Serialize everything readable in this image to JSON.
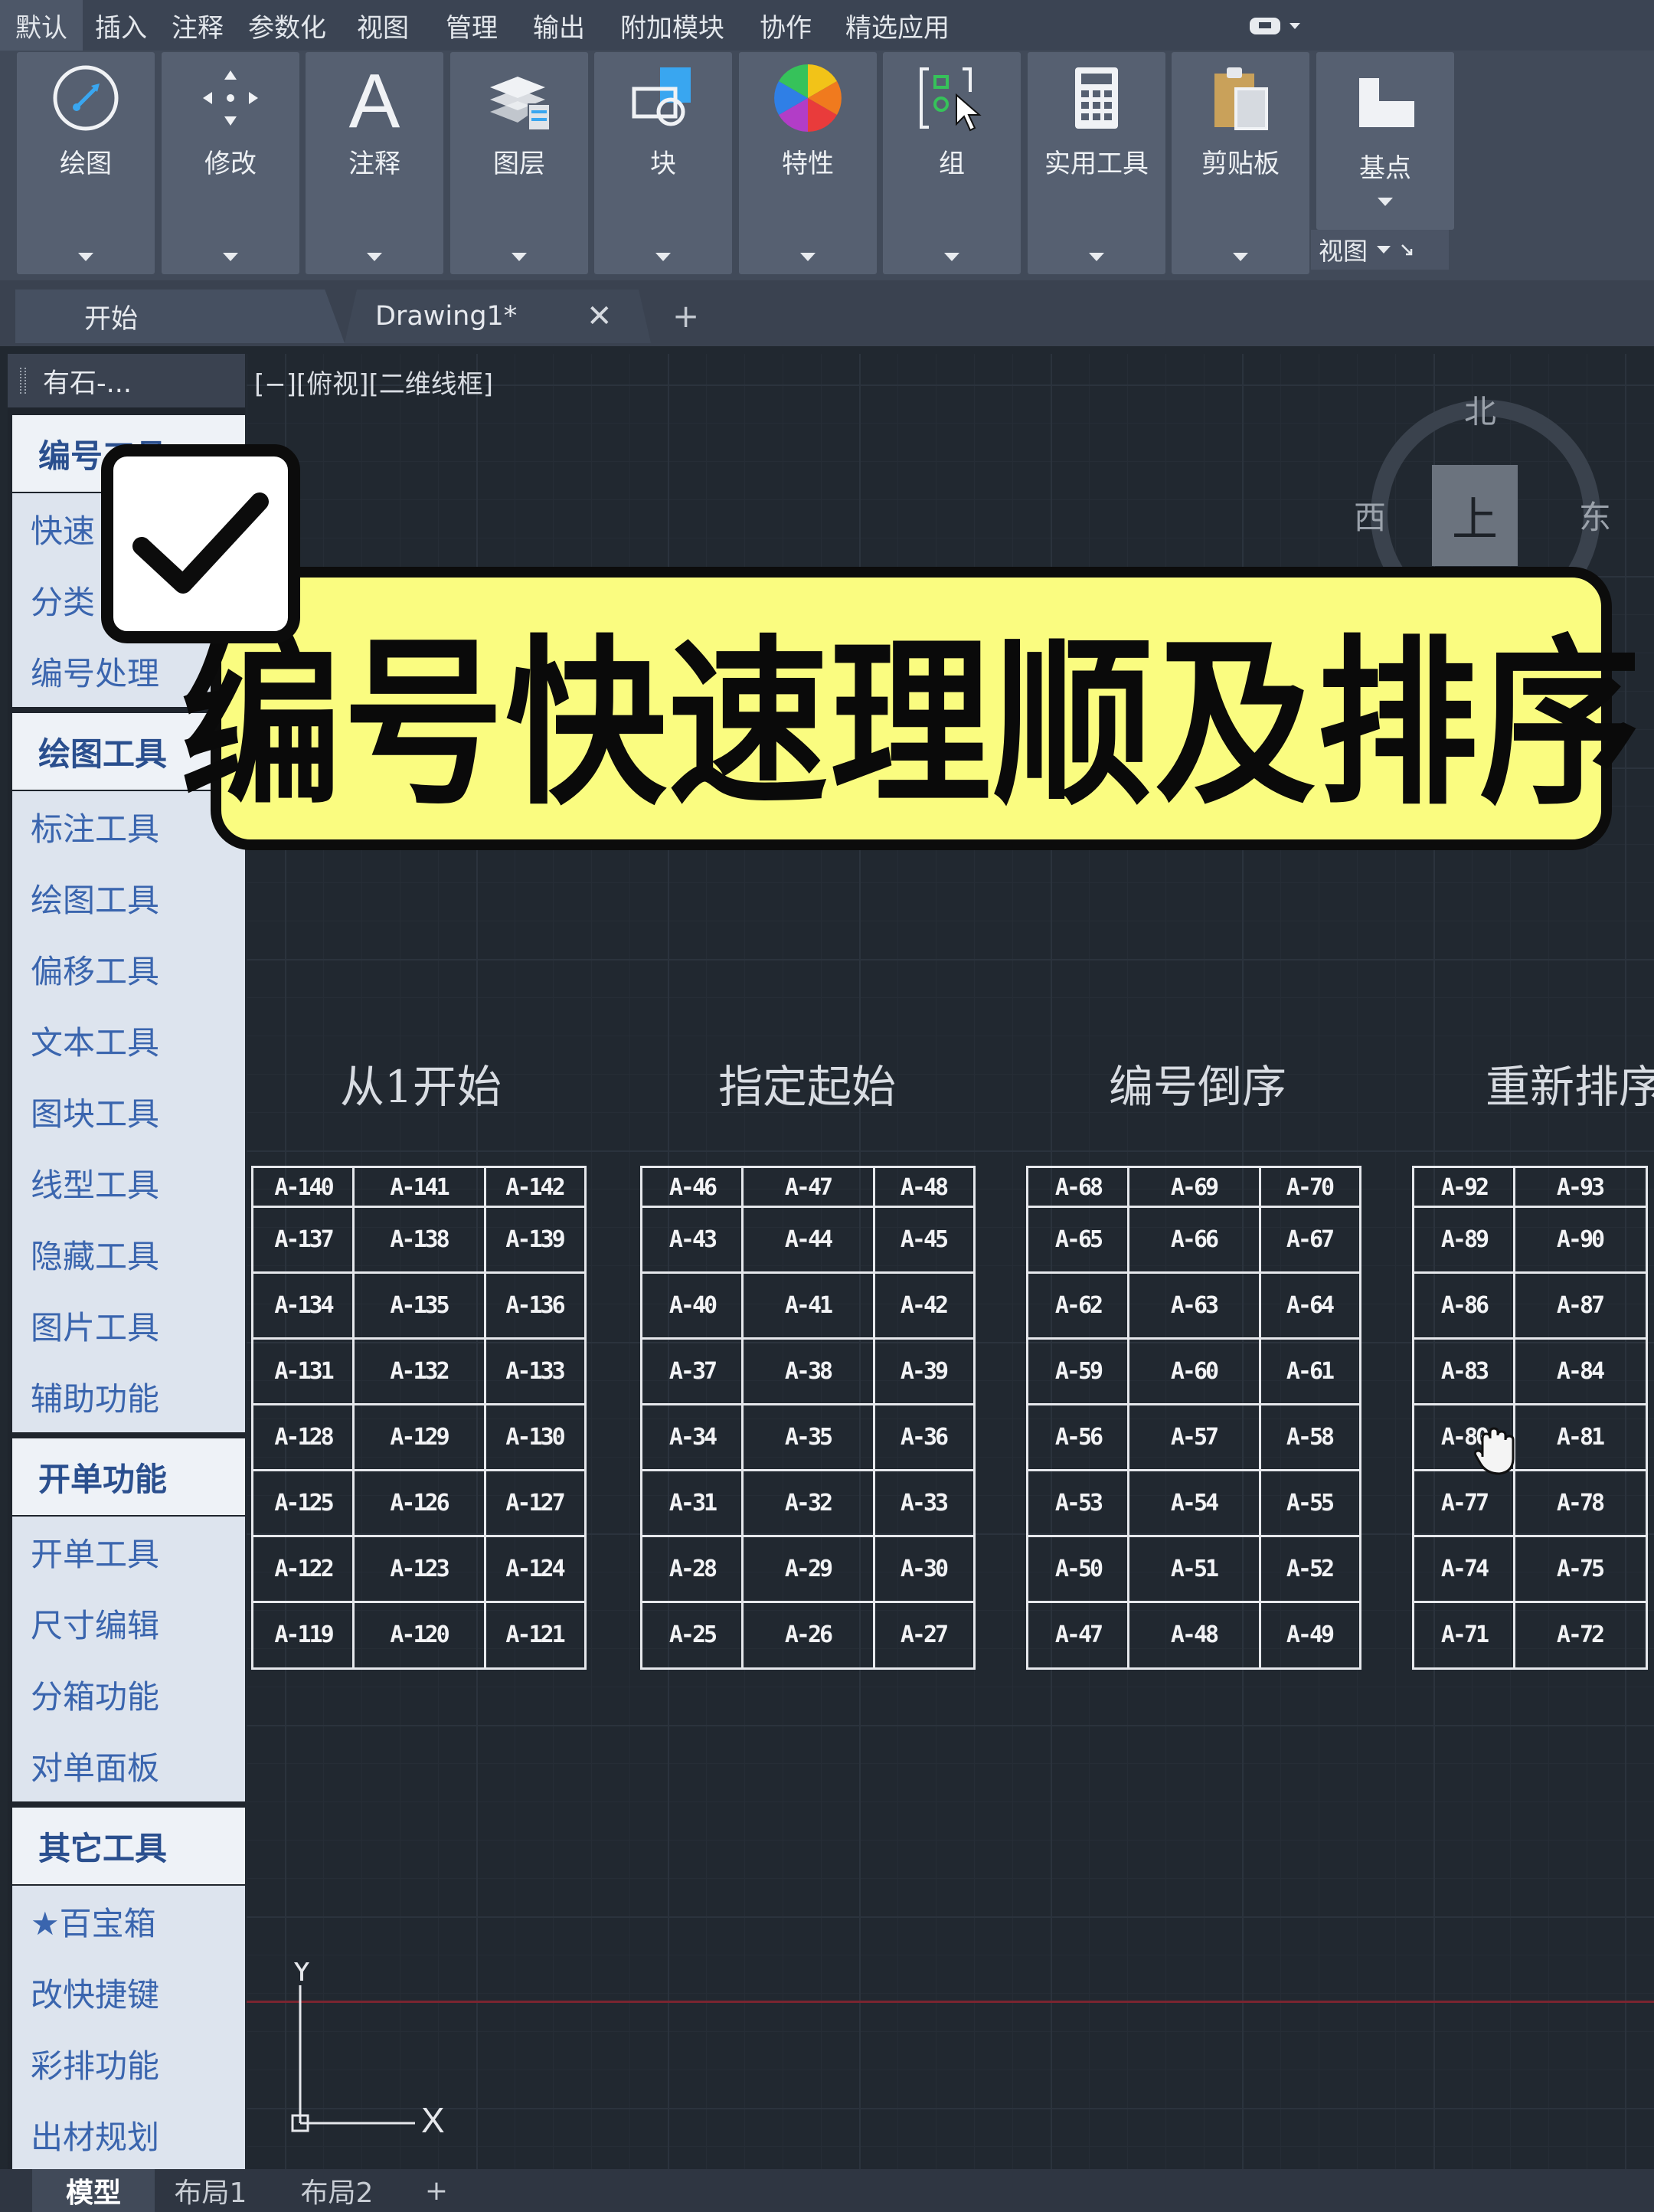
{
  "menu": {
    "items": [
      "默认",
      "插入",
      "注释",
      "参数化",
      "视图",
      "管理",
      "输出",
      "附加模块",
      "协作",
      "精选应用"
    ],
    "active_index": 0
  },
  "ribbon": {
    "panels": [
      {
        "label": "绘图",
        "icon": "draw-circle-icon"
      },
      {
        "label": "修改",
        "icon": "move-arrows-icon"
      },
      {
        "label": "注释",
        "icon": "annotation-text-icon"
      },
      {
        "label": "图层",
        "icon": "layers-icon"
      },
      {
        "label": "块",
        "icon": "block-icon"
      },
      {
        "label": "特性",
        "icon": "color-wheel-icon"
      },
      {
        "label": "组",
        "icon": "group-icon"
      },
      {
        "label": "实用工具",
        "icon": "calculator-icon"
      },
      {
        "label": "剪贴板",
        "icon": "clipboard-icon"
      },
      {
        "label": "基点",
        "icon": "base-point-icon"
      }
    ],
    "view_footer_label": "视图"
  },
  "doc_tabs": {
    "start": "开始",
    "drawing": "Drawing1*",
    "close_symbol": "✕",
    "add_symbol": "+"
  },
  "palette": {
    "title": "有石-...",
    "sections": [
      {
        "title": "编号工具",
        "items": [
          "快速",
          "分类",
          "编号处理"
        ]
      },
      {
        "title": "绘图工具",
        "items": [
          "标注工具",
          "绘图工具",
          "偏移工具",
          "文本工具",
          "图块工具",
          "线型工具",
          "隐藏工具",
          "图片工具",
          "辅助功能"
        ]
      },
      {
        "title": "开单功能",
        "items": [
          "开单工具",
          "尺寸编辑",
          "分箱功能",
          "对单面板"
        ]
      },
      {
        "title": "其它工具",
        "items": [
          "★百宝箱",
          "改快捷键",
          "彩排功能",
          "出材规划"
        ]
      }
    ]
  },
  "viewport": {
    "label": "[−][俯视][二维线框]",
    "compass": {
      "north": "北",
      "west": "西",
      "east": "东",
      "top_face": "上"
    }
  },
  "ucs": {
    "x_label": "X",
    "y_label": "Y"
  },
  "groups": [
    {
      "title": "从1开始",
      "rows": [
        [
          "A-140",
          "A-141",
          "A-142"
        ],
        [
          "A-137",
          "A-138",
          "A-139"
        ],
        [
          "A-134",
          "A-135",
          "A-136"
        ],
        [
          "A-131",
          "A-132",
          "A-133"
        ],
        [
          "A-128",
          "A-129",
          "A-130"
        ],
        [
          "A-125",
          "A-126",
          "A-127"
        ],
        [
          "A-122",
          "A-123",
          "A-124"
        ],
        [
          "A-119",
          "A-120",
          "A-121"
        ]
      ]
    },
    {
      "title": "指定起始",
      "rows": [
        [
          "A-46",
          "A-47",
          "A-48"
        ],
        [
          "A-43",
          "A-44",
          "A-45"
        ],
        [
          "A-40",
          "A-41",
          "A-42"
        ],
        [
          "A-37",
          "A-38",
          "A-39"
        ],
        [
          "A-34",
          "A-35",
          "A-36"
        ],
        [
          "A-31",
          "A-32",
          "A-33"
        ],
        [
          "A-28",
          "A-29",
          "A-30"
        ],
        [
          "A-25",
          "A-26",
          "A-27"
        ]
      ]
    },
    {
      "title": "编号倒序",
      "rows": [
        [
          "A-68",
          "A-69",
          "A-70"
        ],
        [
          "A-65",
          "A-66",
          "A-67"
        ],
        [
          "A-62",
          "A-63",
          "A-64"
        ],
        [
          "A-59",
          "A-60",
          "A-61"
        ],
        [
          "A-56",
          "A-57",
          "A-58"
        ],
        [
          "A-53",
          "A-54",
          "A-55"
        ],
        [
          "A-50",
          "A-51",
          "A-52"
        ],
        [
          "A-47",
          "A-48",
          "A-49"
        ]
      ]
    },
    {
      "title": "重新排序",
      "rows": [
        [
          "A-92",
          "A-93"
        ],
        [
          "A-89",
          "A-90"
        ],
        [
          "A-86",
          "A-87"
        ],
        [
          "A-83",
          "A-84"
        ],
        [
          "A-80",
          "A-81"
        ],
        [
          "A-77",
          "A-78"
        ],
        [
          "A-74",
          "A-75"
        ],
        [
          "A-71",
          "A-72"
        ]
      ]
    }
  ],
  "banner": {
    "text": "编号快速理顺及排序"
  },
  "layout_tabs": {
    "items": [
      "模型",
      "布局1",
      "布局2"
    ],
    "add_symbol": "+",
    "active_index": 0
  }
}
